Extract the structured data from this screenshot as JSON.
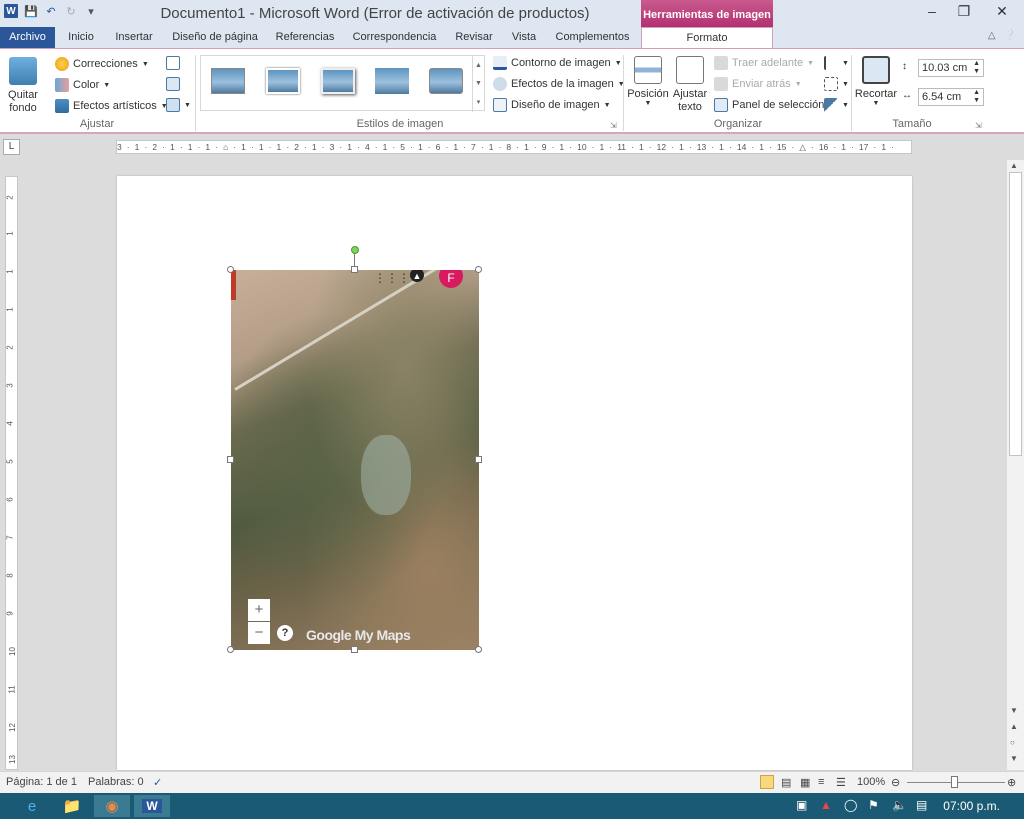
{
  "title": "Documento1  -  Microsoft Word (Error de activación de productos)",
  "context_tab_title": "Herramientas de imagen",
  "tabs": [
    "Archivo",
    "Inicio",
    "Insertar",
    "Diseño de página",
    "Referencias",
    "Correspondencia",
    "Revisar",
    "Vista",
    "Complementos",
    "Formato"
  ],
  "ribbon": {
    "ajustar": {
      "label": "Ajustar",
      "quitar_fondo": "Quitar fondo",
      "correcciones": "Correcciones",
      "color": "Color",
      "efectos_artisticos": "Efectos artísticos"
    },
    "estilos": {
      "label": "Estilos de imagen",
      "contorno": "Contorno de imagen",
      "efectos": "Efectos de la imagen",
      "diseno": "Diseño de imagen"
    },
    "organizar": {
      "label": "Organizar",
      "posicion": "Posición",
      "ajustar_texto": "Ajustar texto",
      "traer_adelante": "Traer adelante",
      "enviar_atras": "Enviar atrás",
      "panel_seleccion": "Panel de selección"
    },
    "tamano": {
      "label": "Tamaño",
      "recortar": "Recortar",
      "height": "10.03 cm",
      "width": "6.54 cm"
    }
  },
  "ruler_h": "3 · 1 · 2 · 1 · 1 · 1 · ⌂ · 1 · 1 · 1 · 2 · 1 · 3 · 1 · 4 · 1 · 5 · 1 · 6 · 1 · 7 · 1 · 8 · 1 · 9 · 1 · 10 · 1 · 11 · 1 · 12 · 1 · 13 · 1 · 14 · 1 · 15 · △ · 16 · 1 · 17 · 1 ·",
  "ruler_v": [
    "2",
    "1",
    "1",
    "1",
    "2",
    "3",
    "4",
    "5",
    "6",
    "7",
    "8",
    "9",
    "10",
    "11",
    "12",
    "13"
  ],
  "map": {
    "avatar_letter": "F",
    "zoom_in": "+",
    "zoom_out": "−",
    "help": "?",
    "branding": "Google My Maps"
  },
  "status": {
    "page": "Página: 1 de 1",
    "words": "Palabras: 0",
    "zoom": "100%"
  },
  "taskbar": {
    "time": "07:00 p.m."
  }
}
